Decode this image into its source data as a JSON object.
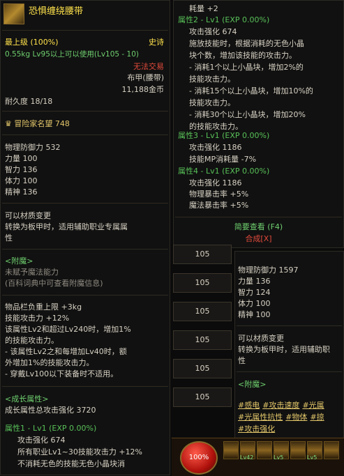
{
  "left": {
    "item_name": "恐惧缠绕腰带",
    "grade": "最上级 (100%)",
    "rarity": "史诗",
    "weight_req": "0.55kg Lv95以上可以使用(Lv105 - 10)",
    "trade": "无法交易",
    "type": "布甲(腰带)",
    "price": "11,188金币",
    "durability": "耐久度 18/18",
    "fame": "冒险家名望 748",
    "stats": [
      "物理防御力 532",
      "力量 100",
      "智力 136",
      "体力 100",
      "精神 136"
    ],
    "material_1": "可以材质变更",
    "material_2": "转换为板甲时，适用辅助职业专属属",
    "material_3": "性",
    "enchant_header": "<附魔>",
    "enchant_1": "未赋予魔法能力",
    "enchant_2": "(百科词典中可查看附魔信息)",
    "effects": [
      "物品栏负重上限 +3kg",
      "技能攻击力 +12%",
      "该属性Lv2和超过Lv240时，增加1%",
      "的技能攻击力。",
      "- 该属性Lv2之和每增加Lv40时，额",
      "外增加1%的技能攻击力。",
      "- 穿戴Lv100以下装备时不适用。"
    ],
    "growth_header": "<成长属性>",
    "growth_total": "成长属性总攻击强化 3720",
    "attr1_title": "属性1 - Lv1 (EXP 0.00%)",
    "attr1_line1": "攻击强化 674",
    "attr1_line2": "所有职业Lv1~30技能攻击力 +12%",
    "attr1_line3": "不消耗无色的技能无色小晶块消"
  },
  "middle": {
    "lines_top": [
      "耗量 +2"
    ],
    "attr2_title": "属性2 - Lv1 (EXP 0.00%)",
    "attr2_lines": [
      "攻击强化 674",
      "施放技能时，根据消耗的无色小晶",
      "块个数，增加该技能的攻击力。",
      "- 消耗1个以上小晶块，增加2%的",
      "技能攻击力。",
      "- 消耗15个以上小晶块，增加10%的",
      "技能攻击力。",
      "- 消耗30个以上小晶块，增加20%",
      "的技能攻击力。"
    ],
    "attr3_title": "属性3 - Lv1 (EXP 0.00%)",
    "attr3_lines": [
      "攻击强化 1186",
      "技能MP消耗量 -7%"
    ],
    "attr4_title": "属性4 - Lv1 (EXP 0.00%)",
    "attr4_lines": [
      "攻击强化 1186",
      "物理暴击率 +5%",
      "魔法暴击率 +5%"
    ],
    "brief": "简要查看 (F4)",
    "synth": "合成[X]"
  },
  "buttons": [
    "105",
    "105",
    "105",
    "105",
    "105",
    "105"
  ],
  "right": {
    "stats": [
      "物理防御力 1597",
      "力量 136",
      "智力 124",
      "体力 100",
      "精神 100"
    ],
    "material_1": "可以材质变更",
    "material_2": "转换为板甲时，适用辅助职",
    "material_3": "性",
    "enchant_header": "<附魔>",
    "tags_row1": [
      "#感电",
      "#攻击速度",
      "#光属"
    ],
    "tags_row2": [
      "#光属性抗性",
      "#物体",
      "#掠"
    ],
    "tags_row3": [
      "#攻击强化"
    ]
  },
  "hud": {
    "hp": "100%",
    "lv_labels": [
      "Lv42",
      "Lv5",
      "Lv5"
    ]
  }
}
